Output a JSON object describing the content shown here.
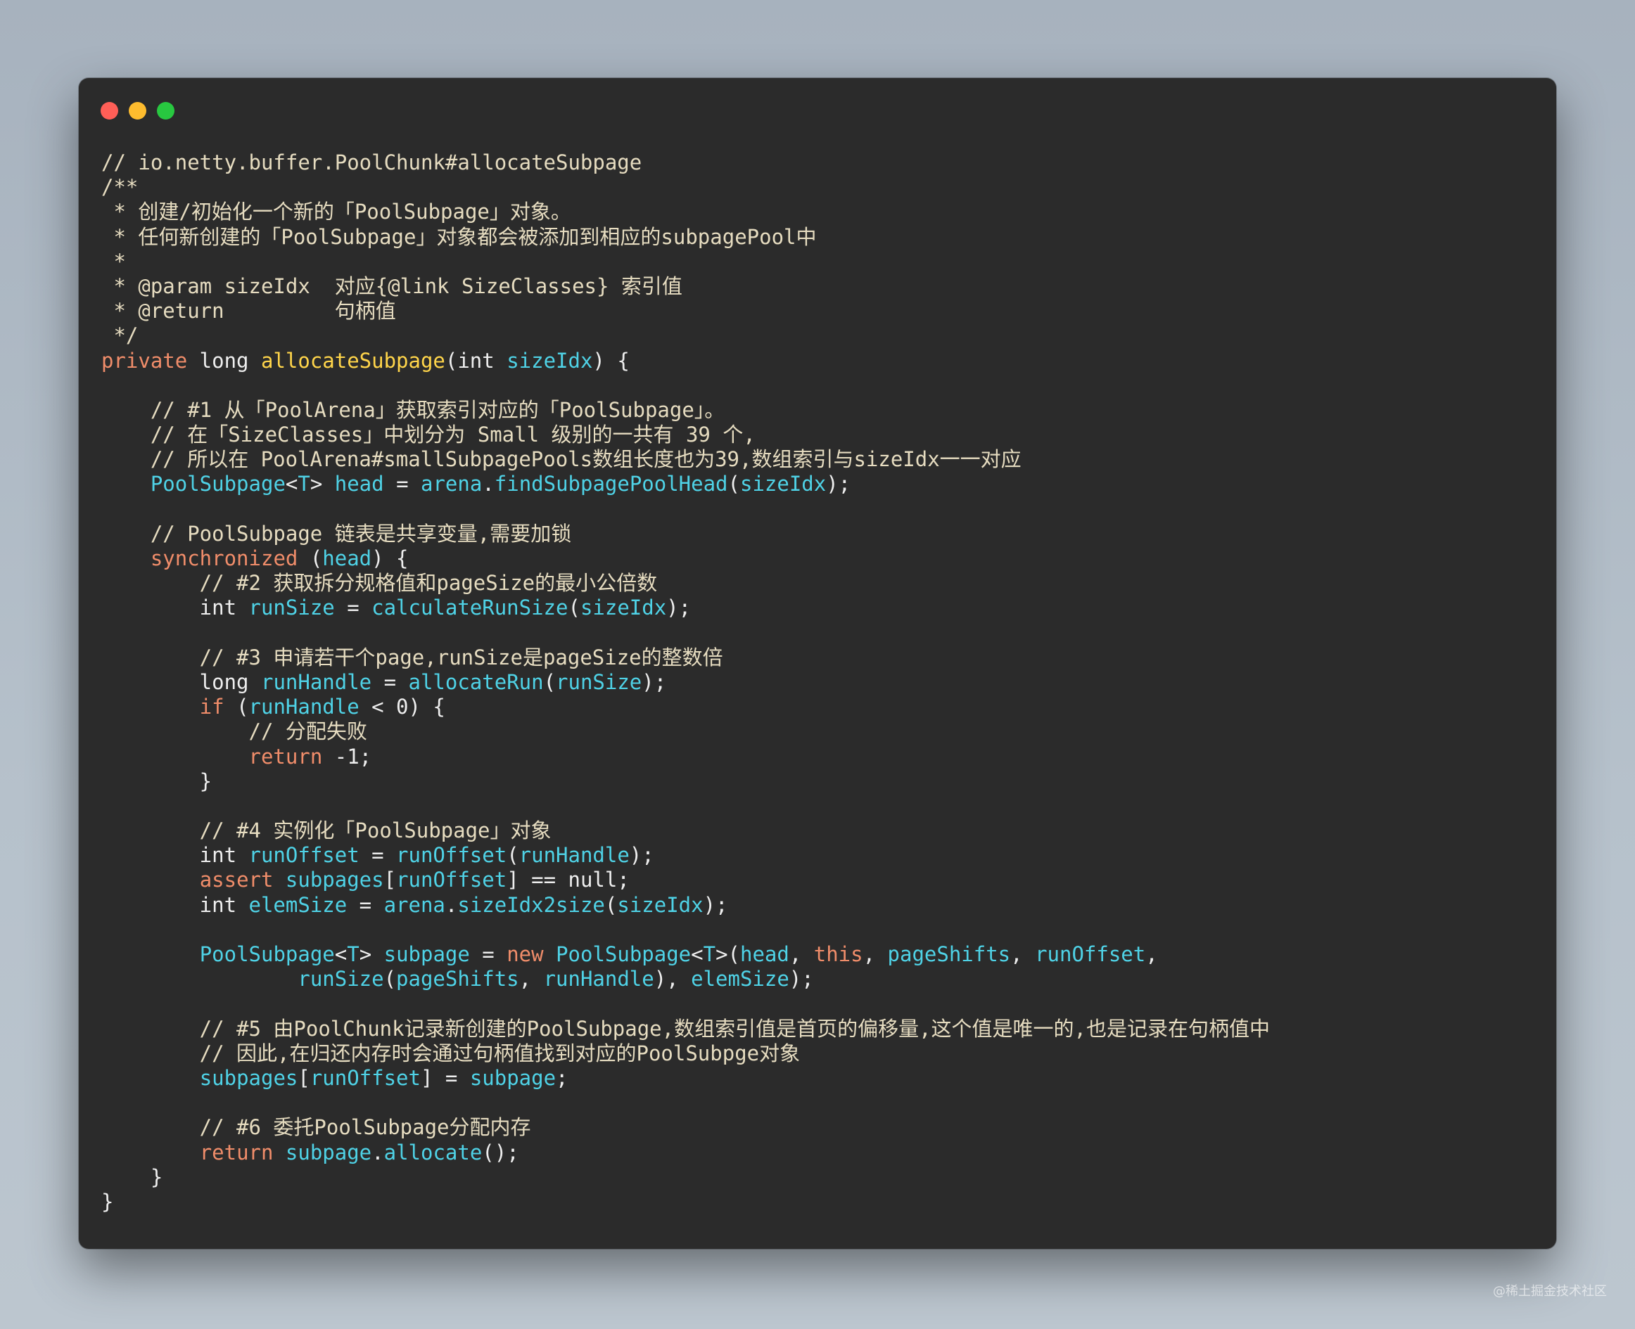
{
  "window": {
    "traffic_lights": [
      {
        "name": "close",
        "color": "#ff5f57"
      },
      {
        "name": "minimize",
        "color": "#febc2e"
      },
      {
        "name": "zoom",
        "color": "#28c840"
      }
    ]
  },
  "theme": {
    "text": "#eeeeee",
    "comment": "#e6dcc0",
    "keyword": "#f08d6a",
    "function": "#ffd54a",
    "identifier": "#4fd2e6",
    "param": "#4fd2e6"
  },
  "code_lines": [
    [
      {
        "t": "// io.netty.buffer.PoolChunk#allocateSubpage",
        "c": "comment"
      }
    ],
    [
      {
        "t": "/**",
        "c": "comment"
      }
    ],
    [
      {
        "t": " * 创建/初始化一个新的「PoolSubpage」对象。",
        "c": "comment"
      }
    ],
    [
      {
        "t": " * 任何新创建的「PoolSubpage」对象都会被添加到相应的subpagePool中",
        "c": "comment"
      }
    ],
    [
      {
        "t": " *",
        "c": "comment"
      }
    ],
    [
      {
        "t": " * @param sizeIdx  对应{@link SizeClasses} 索引值",
        "c": "comment"
      }
    ],
    [
      {
        "t": " * @return         句柄值",
        "c": "comment"
      }
    ],
    [
      {
        "t": " */",
        "c": "comment"
      }
    ],
    [
      {
        "t": "private",
        "c": "keyword"
      },
      {
        "t": " long ",
        "c": "text"
      },
      {
        "t": "allocateSubpage",
        "c": "function"
      },
      {
        "t": "(int ",
        "c": "text"
      },
      {
        "t": "sizeIdx",
        "c": "param"
      },
      {
        "t": ") {",
        "c": "text"
      }
    ],
    [],
    [
      {
        "t": "    // #1 从「PoolArena」获取索引对应的「PoolSubpage」。",
        "c": "comment"
      }
    ],
    [
      {
        "t": "    // 在「SizeClasses」中划分为 Small 级别的一共有 39 个,",
        "c": "comment"
      }
    ],
    [
      {
        "t": "    // 所以在 PoolArena#smallSubpagePools数组长度也为39,数组索引与sizeIdx一一对应",
        "c": "comment"
      }
    ],
    [
      {
        "t": "    ",
        "c": "text"
      },
      {
        "t": "PoolSubpage",
        "c": "identifier"
      },
      {
        "t": "<",
        "c": "text"
      },
      {
        "t": "T",
        "c": "identifier"
      },
      {
        "t": "> ",
        "c": "text"
      },
      {
        "t": "head",
        "c": "identifier"
      },
      {
        "t": " = ",
        "c": "text"
      },
      {
        "t": "arena",
        "c": "identifier"
      },
      {
        "t": ".",
        "c": "text"
      },
      {
        "t": "findSubpagePoolHead",
        "c": "identifier"
      },
      {
        "t": "(",
        "c": "text"
      },
      {
        "t": "sizeIdx",
        "c": "identifier"
      },
      {
        "t": ");",
        "c": "text"
      }
    ],
    [],
    [
      {
        "t": "    // PoolSubpage 链表是共享变量,需要加锁",
        "c": "comment"
      }
    ],
    [
      {
        "t": "    ",
        "c": "text"
      },
      {
        "t": "synchronized",
        "c": "keyword"
      },
      {
        "t": " (",
        "c": "text"
      },
      {
        "t": "head",
        "c": "identifier"
      },
      {
        "t": ") {",
        "c": "text"
      }
    ],
    [
      {
        "t": "        // #2 获取拆分规格值和pageSize的最小公倍数",
        "c": "comment"
      }
    ],
    [
      {
        "t": "        int ",
        "c": "text"
      },
      {
        "t": "runSize",
        "c": "identifier"
      },
      {
        "t": " = ",
        "c": "text"
      },
      {
        "t": "calculateRunSize",
        "c": "identifier"
      },
      {
        "t": "(",
        "c": "text"
      },
      {
        "t": "sizeIdx",
        "c": "identifier"
      },
      {
        "t": ");",
        "c": "text"
      }
    ],
    [],
    [
      {
        "t": "        // #3 申请若干个page,runSize是pageSize的整数倍",
        "c": "comment"
      }
    ],
    [
      {
        "t": "        long ",
        "c": "text"
      },
      {
        "t": "runHandle",
        "c": "identifier"
      },
      {
        "t": " = ",
        "c": "text"
      },
      {
        "t": "allocateRun",
        "c": "identifier"
      },
      {
        "t": "(",
        "c": "text"
      },
      {
        "t": "runSize",
        "c": "identifier"
      },
      {
        "t": ");",
        "c": "text"
      }
    ],
    [
      {
        "t": "        ",
        "c": "text"
      },
      {
        "t": "if",
        "c": "keyword"
      },
      {
        "t": " (",
        "c": "text"
      },
      {
        "t": "runHandle",
        "c": "identifier"
      },
      {
        "t": " < 0) {",
        "c": "text"
      }
    ],
    [
      {
        "t": "            // 分配失败",
        "c": "comment"
      }
    ],
    [
      {
        "t": "            ",
        "c": "text"
      },
      {
        "t": "return",
        "c": "keyword"
      },
      {
        "t": " -1;",
        "c": "text"
      }
    ],
    [
      {
        "t": "        }",
        "c": "text"
      }
    ],
    [],
    [
      {
        "t": "        // #4 实例化「PoolSubpage」对象",
        "c": "comment"
      }
    ],
    [
      {
        "t": "        int ",
        "c": "text"
      },
      {
        "t": "runOffset",
        "c": "identifier"
      },
      {
        "t": " = ",
        "c": "text"
      },
      {
        "t": "runOffset",
        "c": "identifier"
      },
      {
        "t": "(",
        "c": "text"
      },
      {
        "t": "runHandle",
        "c": "identifier"
      },
      {
        "t": ");",
        "c": "text"
      }
    ],
    [
      {
        "t": "        ",
        "c": "text"
      },
      {
        "t": "assert",
        "c": "keyword"
      },
      {
        "t": " ",
        "c": "text"
      },
      {
        "t": "subpages",
        "c": "identifier"
      },
      {
        "t": "[",
        "c": "text"
      },
      {
        "t": "runOffset",
        "c": "identifier"
      },
      {
        "t": "] == null;",
        "c": "text"
      }
    ],
    [
      {
        "t": "        int ",
        "c": "text"
      },
      {
        "t": "elemSize",
        "c": "identifier"
      },
      {
        "t": " = ",
        "c": "text"
      },
      {
        "t": "arena",
        "c": "identifier"
      },
      {
        "t": ".",
        "c": "text"
      },
      {
        "t": "sizeIdx2size",
        "c": "identifier"
      },
      {
        "t": "(",
        "c": "text"
      },
      {
        "t": "sizeIdx",
        "c": "identifier"
      },
      {
        "t": ");",
        "c": "text"
      }
    ],
    [],
    [
      {
        "t": "        ",
        "c": "text"
      },
      {
        "t": "PoolSubpage",
        "c": "identifier"
      },
      {
        "t": "<",
        "c": "text"
      },
      {
        "t": "T",
        "c": "identifier"
      },
      {
        "t": "> ",
        "c": "text"
      },
      {
        "t": "subpage",
        "c": "identifier"
      },
      {
        "t": " = ",
        "c": "text"
      },
      {
        "t": "new",
        "c": "keyword"
      },
      {
        "t": " ",
        "c": "text"
      },
      {
        "t": "PoolSubpage",
        "c": "identifier"
      },
      {
        "t": "<",
        "c": "text"
      },
      {
        "t": "T",
        "c": "identifier"
      },
      {
        "t": ">(",
        "c": "text"
      },
      {
        "t": "head",
        "c": "identifier"
      },
      {
        "t": ", ",
        "c": "text"
      },
      {
        "t": "this",
        "c": "keyword"
      },
      {
        "t": ", ",
        "c": "text"
      },
      {
        "t": "pageShifts",
        "c": "identifier"
      },
      {
        "t": ", ",
        "c": "text"
      },
      {
        "t": "runOffset",
        "c": "identifier"
      },
      {
        "t": ",",
        "c": "text"
      }
    ],
    [
      {
        "t": "                ",
        "c": "text"
      },
      {
        "t": "runSize",
        "c": "identifier"
      },
      {
        "t": "(",
        "c": "text"
      },
      {
        "t": "pageShifts",
        "c": "identifier"
      },
      {
        "t": ", ",
        "c": "text"
      },
      {
        "t": "runHandle",
        "c": "identifier"
      },
      {
        "t": "), ",
        "c": "text"
      },
      {
        "t": "elemSize",
        "c": "identifier"
      },
      {
        "t": ");",
        "c": "text"
      }
    ],
    [],
    [
      {
        "t": "        // #5 由PoolChunk记录新创建的PoolSubpage,数组索引值是首页的偏移量,这个值是唯一的,也是记录在句柄值中",
        "c": "comment"
      }
    ],
    [
      {
        "t": "        // 因此,在归还内存时会通过句柄值找到对应的PoolSubpge对象",
        "c": "comment"
      }
    ],
    [
      {
        "t": "        ",
        "c": "text"
      },
      {
        "t": "subpages",
        "c": "identifier"
      },
      {
        "t": "[",
        "c": "text"
      },
      {
        "t": "runOffset",
        "c": "identifier"
      },
      {
        "t": "] = ",
        "c": "text"
      },
      {
        "t": "subpage",
        "c": "identifier"
      },
      {
        "t": ";",
        "c": "text"
      }
    ],
    [],
    [
      {
        "t": "        // #6 委托PoolSubpage分配内存",
        "c": "comment"
      }
    ],
    [
      {
        "t": "        ",
        "c": "text"
      },
      {
        "t": "return",
        "c": "keyword"
      },
      {
        "t": " ",
        "c": "text"
      },
      {
        "t": "subpage",
        "c": "identifier"
      },
      {
        "t": ".",
        "c": "text"
      },
      {
        "t": "allocate",
        "c": "identifier"
      },
      {
        "t": "();",
        "c": "text"
      }
    ],
    [
      {
        "t": "    }",
        "c": "text"
      }
    ],
    [
      {
        "t": "}",
        "c": "text"
      }
    ]
  ],
  "watermark": "@稀土掘金技术社区"
}
